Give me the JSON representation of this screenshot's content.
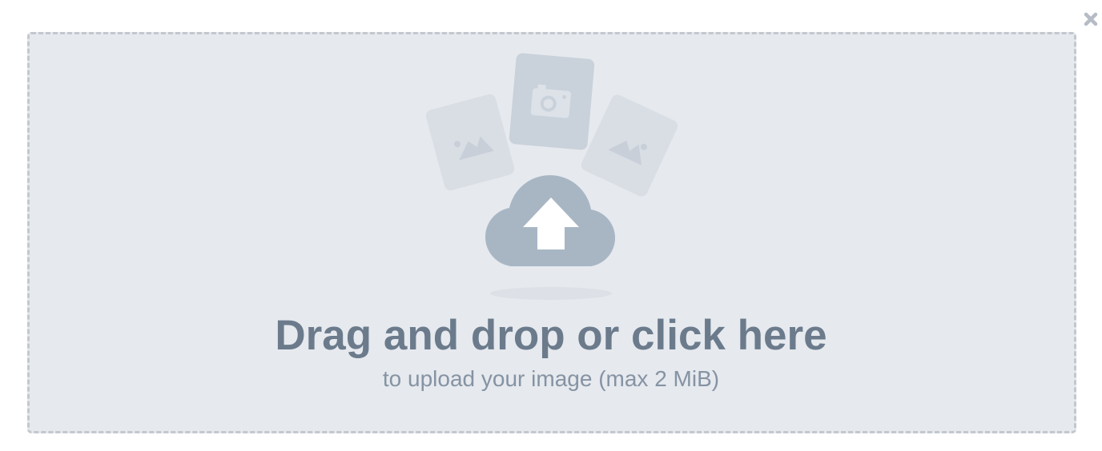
{
  "dialog": {
    "close_icon": "close-icon",
    "dropzone": {
      "title": "Drag and drop or click here",
      "subtitle": "to upload your image (max 2 MiB)",
      "icons": [
        "image-card-icon",
        "camera-card-icon",
        "image-card-icon",
        "cloud-upload-icon"
      ]
    }
  },
  "colors": {
    "dropzone_background": "#e6e9ee",
    "dropzone_border": "#c3c8cf",
    "title_text": "#6b7b8c",
    "subtitle_text": "#8593a3",
    "cloud": "#a7b5c3",
    "card_faded": "#d7dce3",
    "card_main": "#c5ced8"
  }
}
